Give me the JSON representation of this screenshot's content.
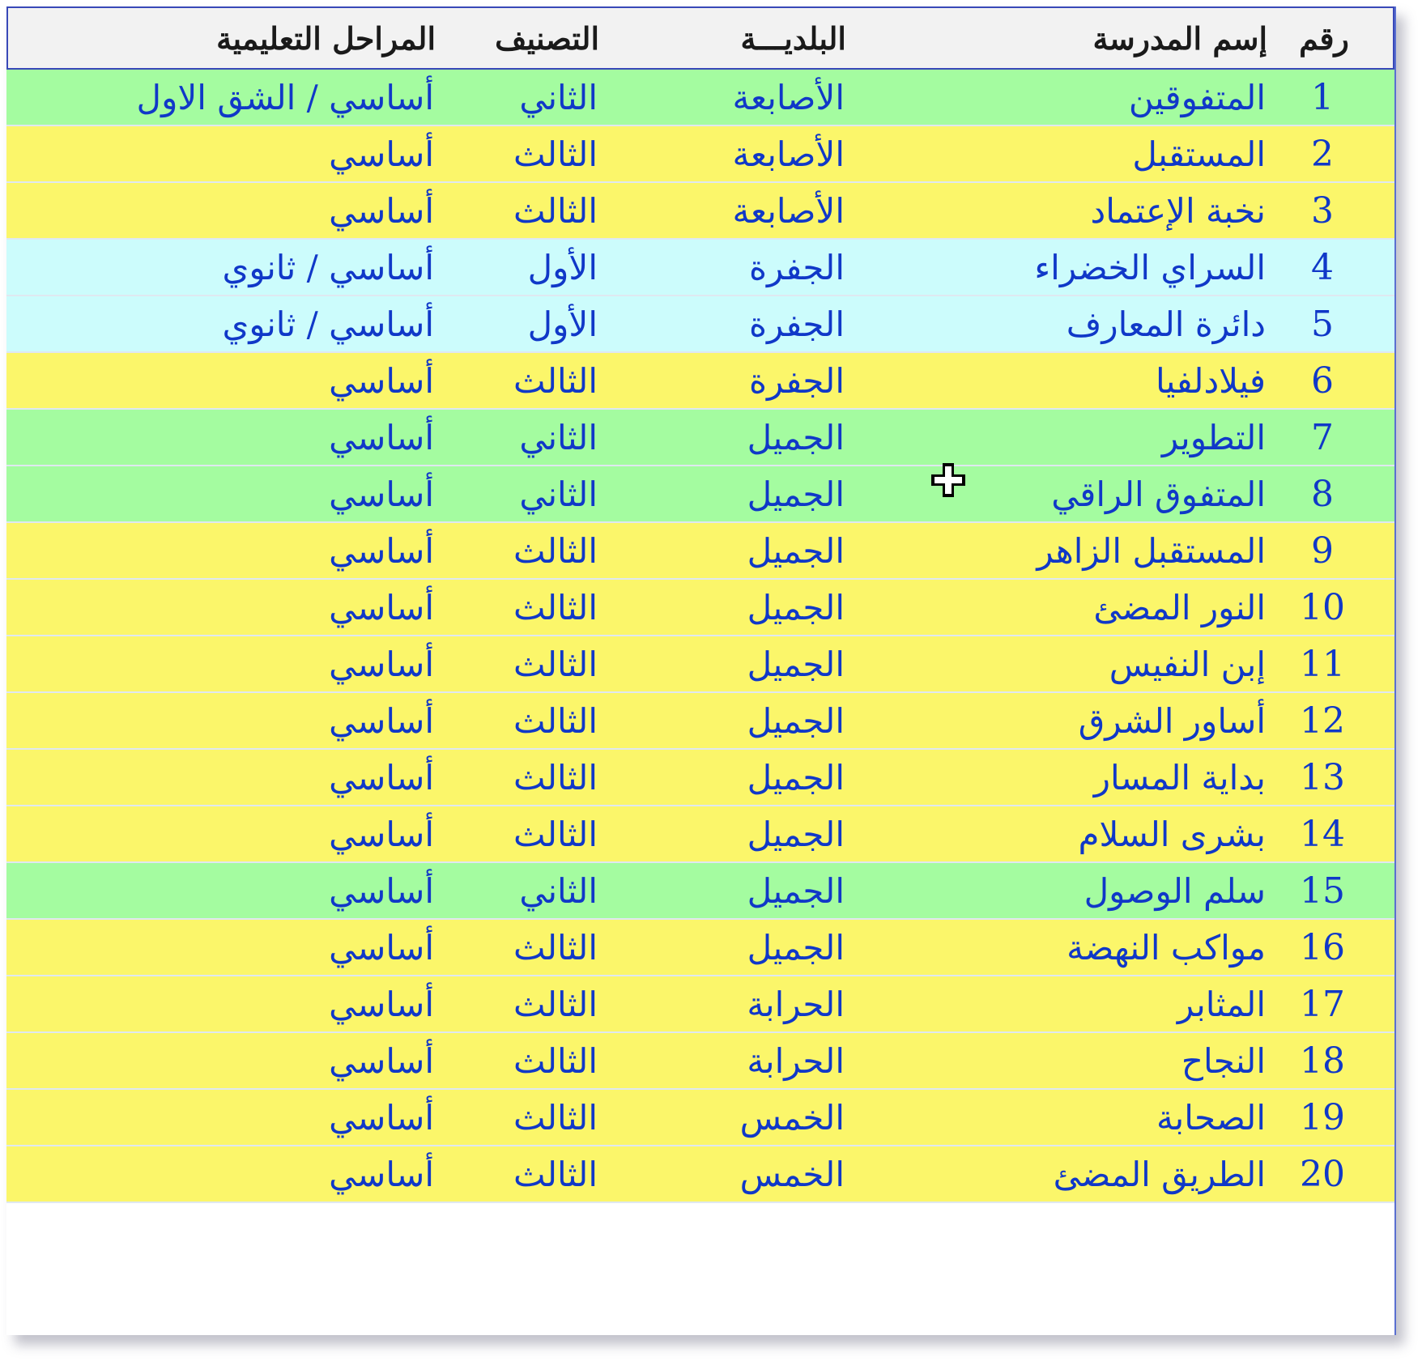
{
  "colors": {
    "header_bg": "#f2f2f2",
    "header_border": "#3848b8",
    "text": "#1038c8",
    "row_yellow": "#fbf66a",
    "row_green": "#a4fca0",
    "row_cyan": "#ccfcfc"
  },
  "header": {
    "num": "رقم",
    "school_name": "إسم المدرسة",
    "municipality": "البلديـــة",
    "classification": "التصنيف",
    "stages": "المراحل التعليمية"
  },
  "rows": [
    {
      "num": "1",
      "name": "المتفوقين",
      "municipality": "الأصابعة",
      "classification": "الثاني",
      "stages": "أساسي / الشق الاول",
      "color": "#a4fca0"
    },
    {
      "num": "2",
      "name": "المستقبل",
      "municipality": "الأصابعة",
      "classification": "الثالث",
      "stages": "أساسي",
      "color": "#fbf66a"
    },
    {
      "num": "3",
      "name": "نخبة الإعتماد",
      "municipality": "الأصابعة",
      "classification": "الثالث",
      "stages": "أساسي",
      "color": "#fbf66a"
    },
    {
      "num": "4",
      "name": "السراي الخضراء",
      "municipality": "الجفرة",
      "classification": "الأول",
      "stages": "أساسي / ثانوي",
      "color": "#ccfcfc"
    },
    {
      "num": "5",
      "name": "دائرة المعارف",
      "municipality": "الجفرة",
      "classification": "الأول",
      "stages": "أساسي / ثانوي",
      "color": "#ccfcfc"
    },
    {
      "num": "6",
      "name": "فيلادلفيا",
      "municipality": "الجفرة",
      "classification": "الثالث",
      "stages": "أساسي",
      "color": "#fbf66a"
    },
    {
      "num": "7",
      "name": "التطوير",
      "municipality": "الجميل",
      "classification": "الثاني",
      "stages": "أساسي",
      "color": "#a4fca0"
    },
    {
      "num": "8",
      "name": "المتفوق الراقي",
      "municipality": "الجميل",
      "classification": "الثاني",
      "stages": "أساسي",
      "color": "#a4fca0"
    },
    {
      "num": "9",
      "name": "المستقبل الزاهر",
      "municipality": "الجميل",
      "classification": "الثالث",
      "stages": "أساسي",
      "color": "#fbf66a"
    },
    {
      "num": "10",
      "name": "النور المضئ",
      "municipality": "الجميل",
      "classification": "الثالث",
      "stages": "أساسي",
      "color": "#fbf66a"
    },
    {
      "num": "11",
      "name": "إبن النفيس",
      "municipality": "الجميل",
      "classification": "الثالث",
      "stages": "أساسي",
      "color": "#fbf66a"
    },
    {
      "num": "12",
      "name": "أساور الشرق",
      "municipality": "الجميل",
      "classification": "الثالث",
      "stages": "أساسي",
      "color": "#fbf66a"
    },
    {
      "num": "13",
      "name": "بداية المسار",
      "municipality": "الجميل",
      "classification": "الثالث",
      "stages": "أساسي",
      "color": "#fbf66a"
    },
    {
      "num": "14",
      "name": "بشرى السلام",
      "municipality": "الجميل",
      "classification": "الثالث",
      "stages": "أساسي",
      "color": "#fbf66a"
    },
    {
      "num": "15",
      "name": "سلم الوصول",
      "municipality": "الجميل",
      "classification": "الثاني",
      "stages": "أساسي",
      "color": "#a4fca0"
    },
    {
      "num": "16",
      "name": "مواكب النهضة",
      "municipality": "الجميل",
      "classification": "الثالث",
      "stages": "أساسي",
      "color": "#fbf66a"
    },
    {
      "num": "17",
      "name": "المثابر",
      "municipality": "الحرابة",
      "classification": "الثالث",
      "stages": "أساسي",
      "color": "#fbf66a"
    },
    {
      "num": "18",
      "name": "النجاح",
      "municipality": "الحرابة",
      "classification": "الثالث",
      "stages": "أساسي",
      "color": "#fbf66a"
    },
    {
      "num": "19",
      "name": "الصحابة",
      "municipality": "الخمس",
      "classification": "الثالث",
      "stages": "أساسي",
      "color": "#fbf66a"
    },
    {
      "num": "20",
      "name": "الطريق المضئ",
      "municipality": "الخمس",
      "classification": "الثالث",
      "stages": "أساسي",
      "color": "#fbf66a"
    }
  ],
  "cursor_icon": "plus-cursor-icon"
}
